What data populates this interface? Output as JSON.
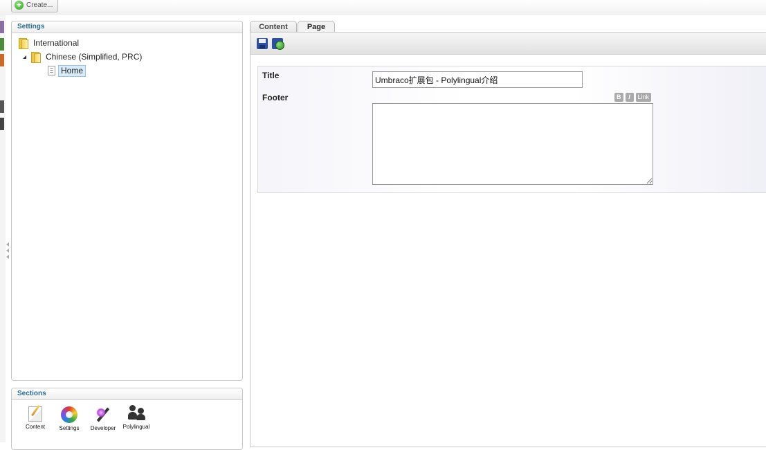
{
  "toolbar": {
    "create_label": "Create..."
  },
  "settings_panel": {
    "title": "Settings",
    "tree": {
      "root": "International",
      "child": "Chinese (Simplified, PRC)",
      "leaf": "Home"
    }
  },
  "sections_panel": {
    "title": "Sections",
    "items": [
      {
        "label": "Content",
        "icon": "pencil-document-icon"
      },
      {
        "label": "Settings",
        "icon": "color-wheel-icon"
      },
      {
        "label": "Developer",
        "icon": "magic-wand-icon"
      },
      {
        "label": "Polylingual",
        "icon": "users-icon"
      }
    ]
  },
  "tabs": [
    {
      "label": "Content",
      "active": false
    },
    {
      "label": "Page",
      "active": true
    }
  ],
  "editor": {
    "title_label": "Title",
    "title_value": "Umbraco扩展包 - Polylingual介绍",
    "footer_label": "Footer",
    "footer_value": "",
    "format_buttons": [
      "B",
      "I",
      "Link"
    ]
  }
}
